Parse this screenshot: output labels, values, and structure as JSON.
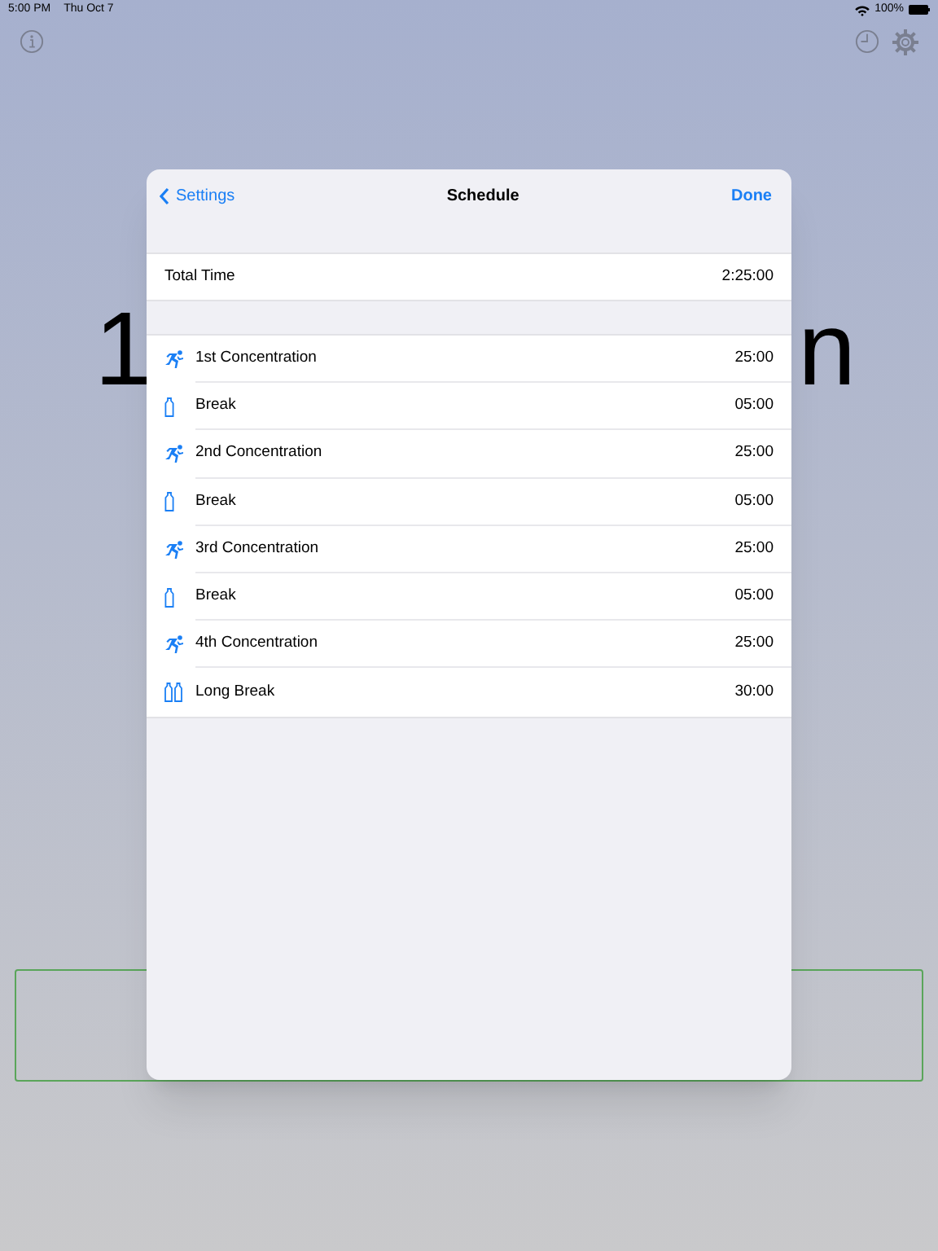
{
  "status_bar": {
    "time": "5:00 PM",
    "date": "Thu Oct 7",
    "battery": "100%"
  },
  "background": {
    "title_fragments": [
      "1",
      "n"
    ]
  },
  "modal": {
    "back": "Settings",
    "title": "Schedule",
    "done": "Done",
    "total": {
      "label": "Total Time",
      "value": "2:25:00"
    },
    "items": [
      {
        "kind": "work",
        "label": "1st Concentration",
        "duration": "25:00"
      },
      {
        "kind": "break",
        "label": "Break",
        "duration": "05:00"
      },
      {
        "kind": "work",
        "label": "2nd Concentration",
        "duration": "25:00"
      },
      {
        "kind": "break",
        "label": "Break",
        "duration": "05:00"
      },
      {
        "kind": "work",
        "label": "3rd Concentration",
        "duration": "25:00"
      },
      {
        "kind": "break",
        "label": "Break",
        "duration": "05:00"
      },
      {
        "kind": "work",
        "label": "4th Concentration",
        "duration": "25:00"
      },
      {
        "kind": "long_break",
        "label": "Long Break",
        "duration": "30:00"
      }
    ]
  }
}
